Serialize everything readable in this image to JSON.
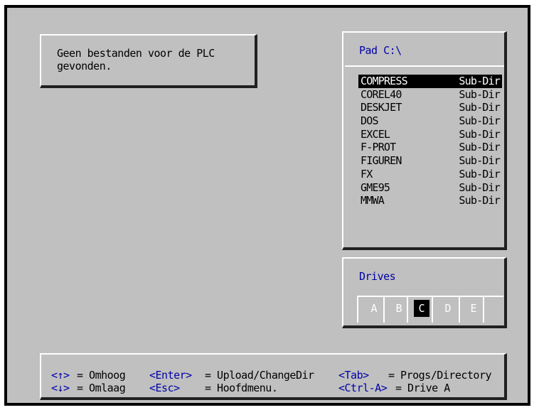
{
  "message": {
    "line1": "Geen bestanden voor de PLC",
    "line2": "gevonden."
  },
  "path_panel": {
    "title": "Pad C:\\",
    "entries": [
      {
        "name": "COMPRESS",
        "type": "Sub-Dir",
        "selected": true
      },
      {
        "name": "COREL40",
        "type": "Sub-Dir"
      },
      {
        "name": "DESKJET",
        "type": "Sub-Dir"
      },
      {
        "name": "DOS",
        "type": "Sub-Dir"
      },
      {
        "name": "EXCEL",
        "type": "Sub-Dir"
      },
      {
        "name": "F-PROT",
        "type": "Sub-Dir"
      },
      {
        "name": "FIGUREN",
        "type": "Sub-Dir"
      },
      {
        "name": "FX",
        "type": "Sub-Dir"
      },
      {
        "name": "GME95",
        "type": "Sub-Dir"
      },
      {
        "name": "MMWA",
        "type": "Sub-Dir"
      }
    ]
  },
  "drives_panel": {
    "title": "Drives",
    "drives": [
      "A",
      "B",
      "C",
      "D",
      "E"
    ],
    "selected": "C"
  },
  "help": {
    "up_key": "<↑>",
    "up_desc": "= Omhoog",
    "down_key": "<↓>",
    "down_desc": "= Omlaag",
    "enter_key": "<Enter>",
    "enter_desc": "= Upload/ChangeDir",
    "esc_key": "<Esc>",
    "esc_desc": "= Hoofdmenu.",
    "tab_key": "<Tab>",
    "tab_desc": "= Progs/Directory",
    "ctrla_key": "<Ctrl-A>",
    "ctrla_desc": "= Drive A"
  },
  "colors": {
    "background": "#c0c0c0",
    "accent_text": "#0000a8",
    "selection": "#000000"
  }
}
